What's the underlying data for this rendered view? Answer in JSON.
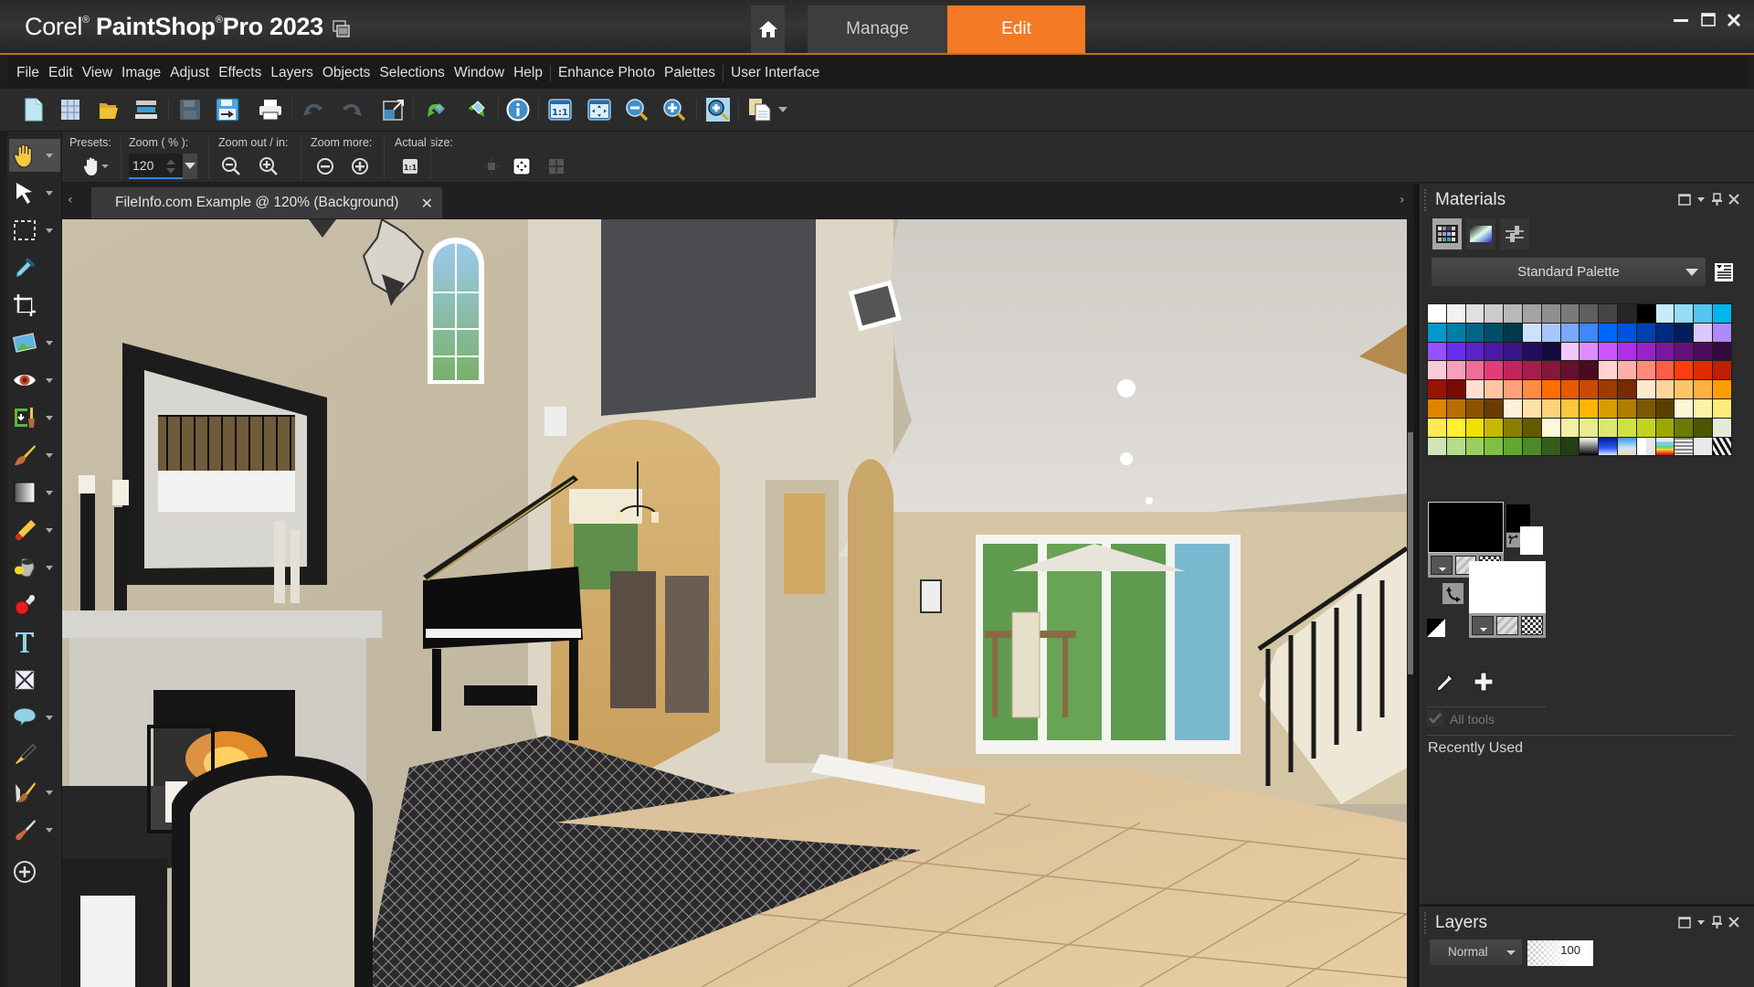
{
  "app": {
    "brand_prefix": "Corel",
    "brand_name": "PaintShop",
    "product": "Pro 2023",
    "registered_mark": "®",
    "title_icon": "window-list-icon"
  },
  "workspace_tabs": {
    "home_icon": "home-icon",
    "items": [
      {
        "label": "Manage",
        "active": false
      },
      {
        "label": "Edit",
        "active": true
      }
    ],
    "accent_color": "#f47a26"
  },
  "window_controls": {
    "minimize": "minimize-icon",
    "maximize": "maximize-icon",
    "close": "close-icon"
  },
  "menu": {
    "items": [
      "File",
      "Edit",
      "View",
      "Image",
      "Adjust",
      "Effects",
      "Layers",
      "Objects",
      "Selections",
      "Window",
      "Help",
      "Enhance Photo",
      "Palettes",
      "User Interface"
    ]
  },
  "toolbar": {
    "buttons": [
      {
        "name": "new-image",
        "icon": "new-file-icon"
      },
      {
        "name": "new-from-template",
        "icon": "grid-icon"
      },
      {
        "name": "open",
        "icon": "folder-icon"
      },
      {
        "name": "scan",
        "icon": "scanner-icon"
      },
      {
        "name": "save",
        "icon": "save-icon"
      },
      {
        "name": "save-as",
        "icon": "save-as-icon"
      },
      {
        "name": "print",
        "icon": "printer-icon"
      },
      {
        "name": "undo",
        "icon": "undo-icon"
      },
      {
        "name": "redo",
        "icon": "redo-icon"
      },
      {
        "name": "resize",
        "icon": "resize-icon"
      },
      {
        "name": "rotate-left",
        "icon": "rotate-left-icon"
      },
      {
        "name": "rotate-right",
        "icon": "rotate-right-icon"
      },
      {
        "name": "image-info",
        "icon": "info-icon"
      },
      {
        "name": "actual-size",
        "icon": "actual-size-icon"
      },
      {
        "name": "fit-to-window",
        "icon": "fit-window-icon"
      },
      {
        "name": "zoom-out",
        "icon": "zoom-out-icon"
      },
      {
        "name": "zoom-in",
        "icon": "zoom-in-icon"
      },
      {
        "name": "zoom-more",
        "icon": "zoom-magnifier-icon"
      },
      {
        "name": "copy-special",
        "icon": "copy-special-icon"
      }
    ]
  },
  "tool_options": {
    "presets_label": "Presets:",
    "zoom_label": "Zoom ( % ):",
    "zoom_value": "120",
    "zoom_out_in_label": "Zoom out / in:",
    "zoom_more_label": "Zoom more:",
    "actual_size_label": "Actual size:",
    "actual_size_glyph": "1:1"
  },
  "toolbox": {
    "tools": [
      {
        "name": "pan",
        "icon": "hand-icon",
        "dropdown": true,
        "active": true
      },
      {
        "name": "pick",
        "icon": "arrow-cursor-icon",
        "dropdown": true
      },
      {
        "name": "selection",
        "icon": "marquee-icon",
        "dropdown": true
      },
      {
        "name": "dropper",
        "icon": "eyedropper-icon",
        "dropdown": false
      },
      {
        "name": "crop",
        "icon": "crop-icon",
        "dropdown": false
      },
      {
        "name": "straighten",
        "icon": "photo-icon",
        "dropdown": true
      },
      {
        "name": "red-eye",
        "icon": "eye-icon",
        "dropdown": true
      },
      {
        "name": "clone",
        "icon": "clone-brush-icon",
        "dropdown": true
      },
      {
        "name": "paint-brush",
        "icon": "paint-brush-icon",
        "dropdown": true
      },
      {
        "name": "gradient",
        "icon": "gradient-icon",
        "dropdown": true
      },
      {
        "name": "eraser",
        "icon": "eraser-icon",
        "dropdown": true
      },
      {
        "name": "flood-fill",
        "icon": "paint-bucket-icon",
        "dropdown": true
      },
      {
        "name": "picture-tube",
        "icon": "stamp-icon",
        "dropdown": false
      },
      {
        "name": "text",
        "icon": "text-icon",
        "dropdown": false
      },
      {
        "name": "warp",
        "icon": "warp-icon",
        "dropdown": false
      },
      {
        "name": "preset-shape",
        "icon": "speech-bubble-icon",
        "dropdown": true
      },
      {
        "name": "pen",
        "icon": "pen-nib-icon",
        "dropdown": false
      },
      {
        "name": "smudge",
        "icon": "smudge-brush-icon",
        "dropdown": true
      },
      {
        "name": "retouch",
        "icon": "retouch-brush-icon",
        "dropdown": true
      },
      {
        "name": "customize",
        "icon": "add-circle-icon",
        "dropdown": false
      }
    ]
  },
  "document": {
    "tab_label": "FileInfo.com Example @ 120% (Background)",
    "prev_glyph": "‹",
    "next_glyph": "›",
    "close_glyph": "✕",
    "image_description": "Living room interior with fireplace, grand piano, patterned rug and tiled floor"
  },
  "materials": {
    "title": "Materials",
    "tabs": [
      {
        "name": "swatches",
        "active": true
      },
      {
        "name": "rainbow",
        "active": false
      },
      {
        "name": "sliders",
        "active": false
      }
    ],
    "palette_name": "Standard Palette",
    "swatches": [
      "#ffffff",
      "#f2f2f2",
      "#e0e0e0",
      "#cccccc",
      "#b8b8b8",
      "#a3a3a3",
      "#8f8f8f",
      "#7a7a7a",
      "#5f5f5f",
      "#454545",
      "#262626",
      "#000000",
      "#c6ecfb",
      "#95dcf7",
      "#52c5f0",
      "#00b6ee",
      "#0099cc",
      "#007fa8",
      "#006685",
      "#004f66",
      "#003a4a",
      "#cfe0ff",
      "#a7c6ff",
      "#7aa8ff",
      "#3d87ff",
      "#0066ff",
      "#0052e0",
      "#0040b0",
      "#002b80",
      "#001f5c",
      "#dcc8ff",
      "#b088ff",
      "#9650ff",
      "#6a2ef0",
      "#5a22c8",
      "#4a1aa8",
      "#38158a",
      "#220e5c",
      "#160840",
      "#f0c8ff",
      "#e08cff",
      "#cc55ff",
      "#b22ee8",
      "#9a22c8",
      "#7a18a0",
      "#66127a",
      "#4a0e5c",
      "#330a40",
      "#f7cbd7",
      "#f59fbb",
      "#ee6e96",
      "#e23d7a",
      "#c72260",
      "#a31e4c",
      "#86173c",
      "#66102e",
      "#4a0a20",
      "#ffd4d0",
      "#ffb0a6",
      "#ff8a7a",
      "#ff5c4a",
      "#ff3d10",
      "#e02a00",
      "#c01e00",
      "#9a1200",
      "#7a0a00",
      "#ffe0d0",
      "#ffc4a0",
      "#ffa07a",
      "#ff8c40",
      "#ff6e00",
      "#e65a00",
      "#c94a00",
      "#a03a00",
      "#7a2a00",
      "#ffe8cc",
      "#ffd49a",
      "#ffc46a",
      "#ffb040",
      "#ff9e00",
      "#e08400",
      "#b86e00",
      "#8c5200",
      "#6a3c00",
      "#fff0d8",
      "#ffe0a6",
      "#ffd27a",
      "#ffc440",
      "#ffb600",
      "#d99c00",
      "#b07e00",
      "#7a5a00",
      "#5a4000",
      "#fff6d8",
      "#fff2a6",
      "#ffec7a",
      "#ffea55",
      "#fff030",
      "#f2e000",
      "#c9b800",
      "#8a7e00",
      "#635a00",
      "#fdf8d8",
      "#f2f2a6",
      "#e8ec8c",
      "#dde670",
      "#d2e040",
      "#c2d420",
      "#9aa800",
      "#6e7a00",
      "#4e5500",
      "#e4ecd8",
      "#d0e4b8",
      "#b4dc8c",
      "#98d060",
      "#7ec043",
      "#62a830",
      "#4a8a28",
      "#355e1e",
      "#243d12",
      "gradient:bw",
      "gradient:blue",
      "gradient:sky",
      "pattern:light",
      "pattern:rainbow",
      "pattern:stripes",
      "#e8e8e8",
      "pattern:zebra"
    ],
    "foreground_color": "#000000",
    "background_color": "#ffffff",
    "all_tools_label": "All tools",
    "all_tools_checked": true,
    "recently_used_label": "Recently Used"
  },
  "layers": {
    "title": "Layers",
    "blend_mode": "Normal",
    "opacity": "100"
  }
}
